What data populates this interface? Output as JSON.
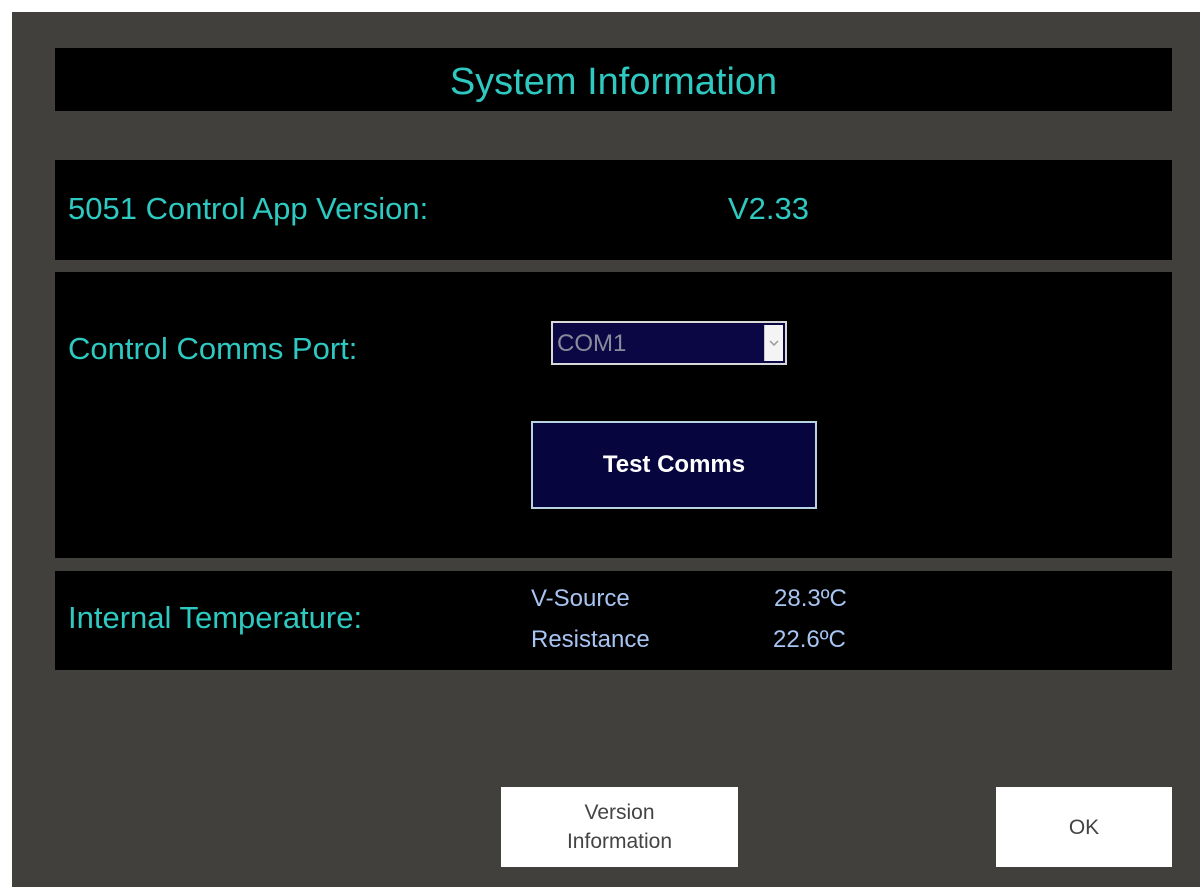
{
  "title": "System Information",
  "version": {
    "label": "5051 Control App Version:",
    "value": "V2.33"
  },
  "comms": {
    "label": "Control Comms Port:",
    "port_value": "COM1",
    "test_button": "Test Comms"
  },
  "temperature": {
    "label": "Internal Temperature:",
    "rows": [
      {
        "name": "V-Source",
        "value": "28.3ºC"
      },
      {
        "name": "Resistance",
        "value": "22.6ºC"
      }
    ]
  },
  "footer": {
    "version_info_line1": "Version",
    "version_info_line2": "Information",
    "ok": "OK"
  },
  "colors": {
    "window_bg": "#42403d",
    "panel_bg": "#000000",
    "accent_cyan": "#2ec9c1",
    "button_navy": "#06053d"
  }
}
